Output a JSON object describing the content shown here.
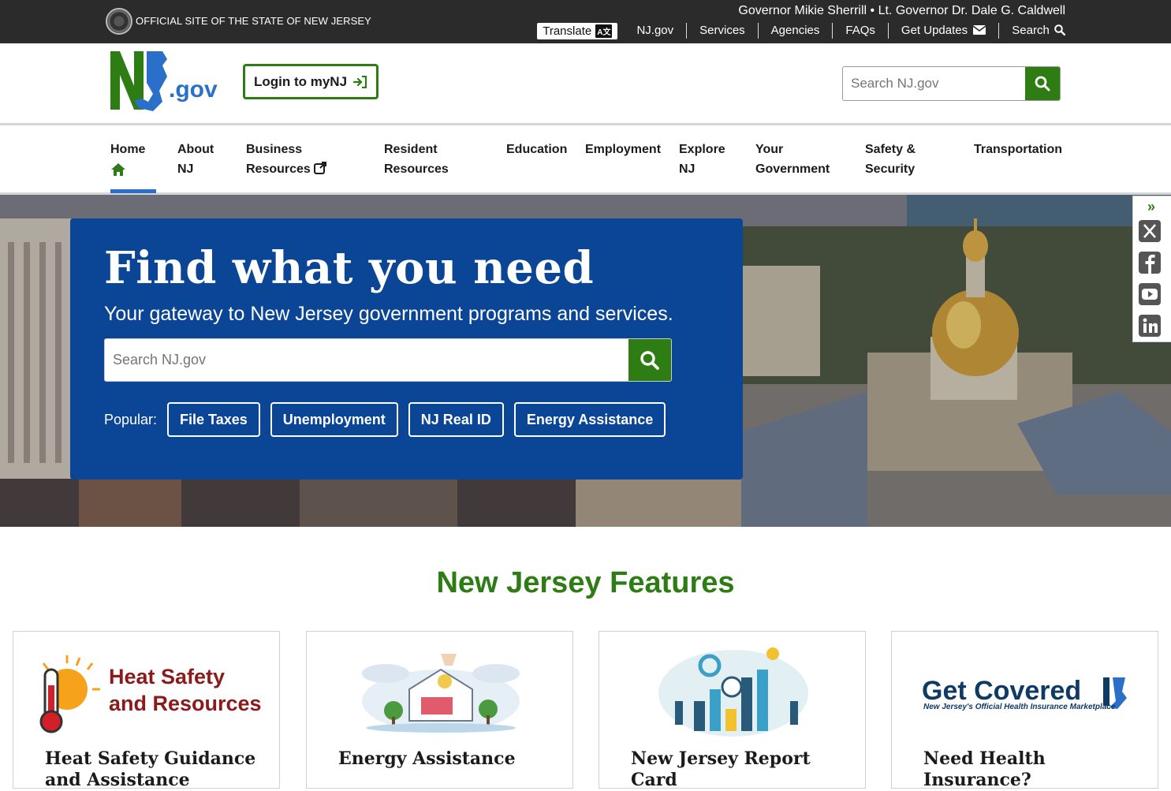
{
  "topbar": {
    "official": "OFFICIAL SITE OF THE STATE OF NEW JERSEY",
    "governor": "Governor Mikie Sherrill • Lt. Governor Dr. Dale G. Caldwell",
    "translate": "Translate",
    "translate_badge": "A文",
    "links": [
      "NJ.gov",
      "Services",
      "Agencies",
      "FAQs",
      "Get Updates",
      "Search"
    ]
  },
  "header": {
    "logo_letters": "NJ",
    "logo_suffix": ".gov",
    "login_label": "Login to myNJ",
    "search_placeholder": "Search NJ.gov"
  },
  "nav": {
    "items": [
      {
        "line1": "Home",
        "line2": ""
      },
      {
        "line1": "About",
        "line2": "NJ"
      },
      {
        "line1": "Business",
        "line2": "Resources"
      },
      {
        "line1": "Resident",
        "line2": "Resources"
      },
      {
        "line1": "Education",
        "line2": ""
      },
      {
        "line1": "Employment",
        "line2": ""
      },
      {
        "line1": "Explore",
        "line2": "NJ"
      },
      {
        "line1": "Your",
        "line2": "Government"
      },
      {
        "line1": "Safety &",
        "line2": "Security"
      },
      {
        "line1": "Transportation",
        "line2": ""
      }
    ]
  },
  "hero": {
    "title": "Find what you need",
    "subtitle": "Your gateway to New Jersey government programs and services.",
    "search_placeholder": "Search NJ.gov",
    "popular_label": "Popular:",
    "popular": [
      "File Taxes",
      "Unemployment",
      "NJ Real ID",
      "Energy Assistance"
    ]
  },
  "social": [
    "x-icon",
    "facebook-icon",
    "youtube-icon",
    "linkedin-icon"
  ],
  "features": {
    "title": "New Jersey Features",
    "cards": [
      {
        "title": "Heat Safety Guidance and Assistance",
        "image_text_1": "Heat Safety",
        "image_text_2": "and Resources"
      },
      {
        "title": "Energy Assistance"
      },
      {
        "title": "New Jersey Report Card"
      },
      {
        "title": "Need Health Insurance?",
        "image_text_1": "Get Covered",
        "image_text_2": "New Jersey's Official Health Insurance Marketplace"
      }
    ]
  },
  "colors": {
    "green": "#2e7d14",
    "blue": "#0b4596",
    "topbar": "#2b2b2b",
    "heat_red": "#8b1a1a"
  }
}
